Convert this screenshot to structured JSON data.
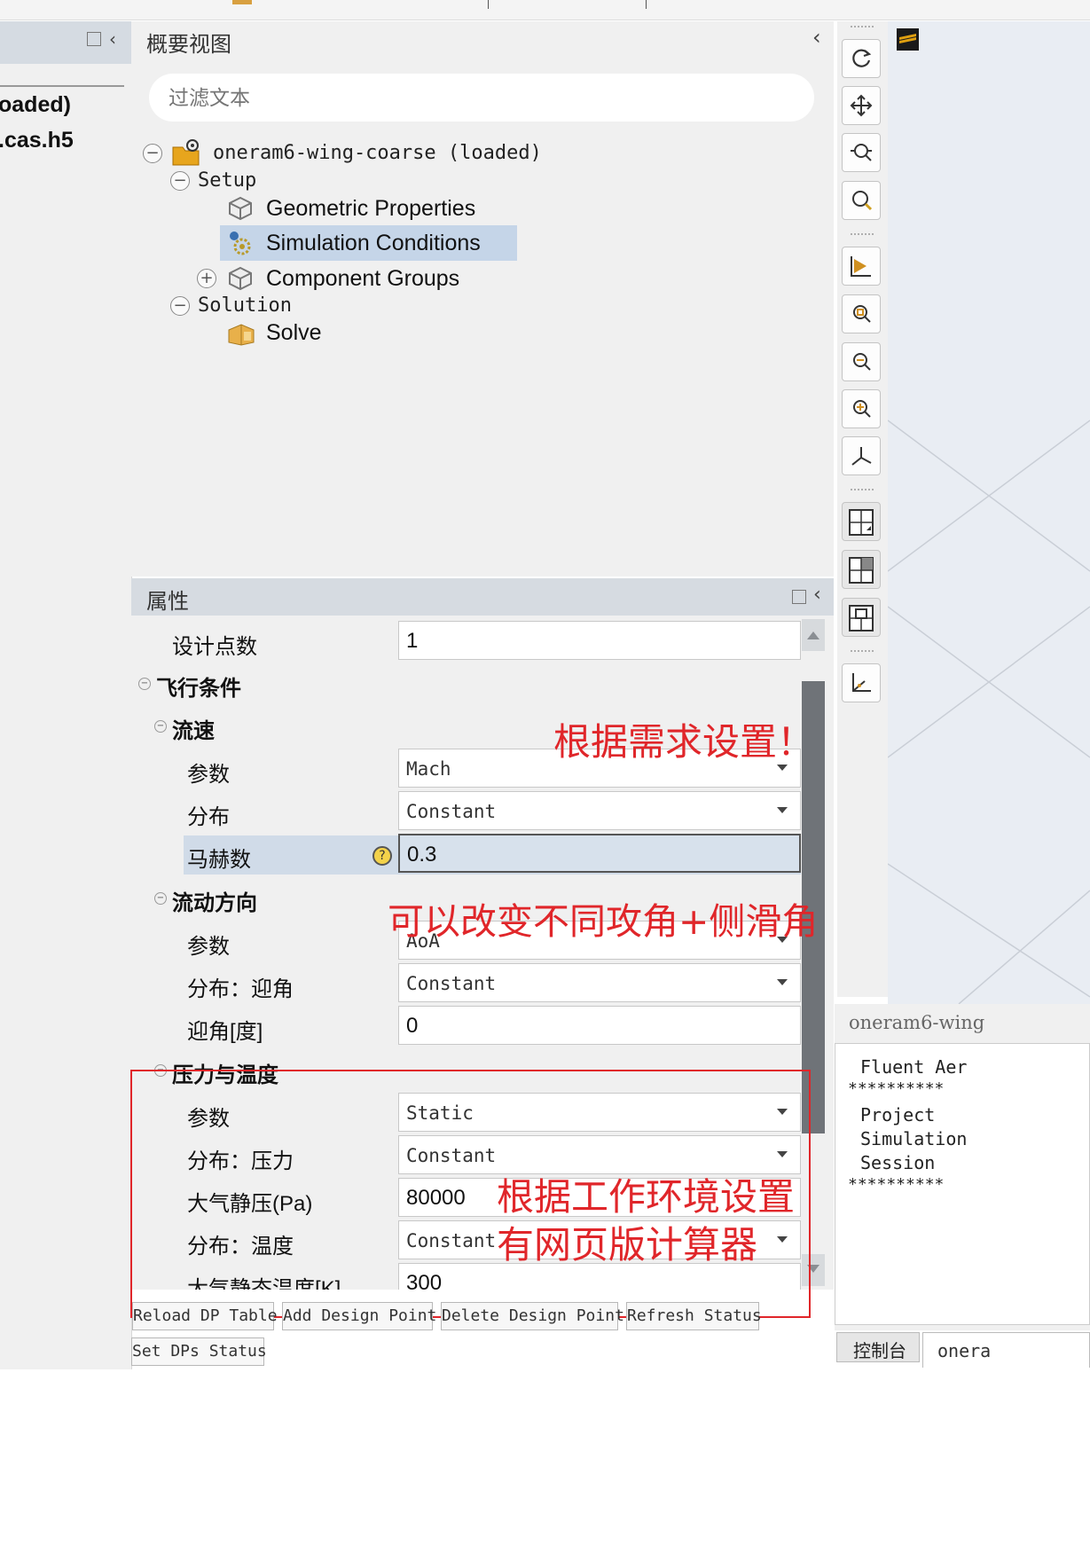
{
  "left_panel": {
    "text_line1": "oaded)",
    "text_line2": ".cas.h5"
  },
  "outline": {
    "title": "概要视图",
    "filter_placeholder": "过滤文本",
    "tree": {
      "root_label": "oneram6-wing-coarse (loaded)",
      "setup_label": "Setup",
      "geometric_label": "Geometric Properties",
      "simulation_label": "Simulation Conditions",
      "component_label": "Component Groups",
      "solution_label": "Solution",
      "solve_label": "Solve"
    }
  },
  "properties": {
    "title": "属性",
    "design_points_label": "设计点数",
    "design_points_value": "1",
    "flight_conditions": "飞行条件",
    "flow_speed": {
      "section": "流速",
      "param_label": "参数",
      "param_value": "Mach",
      "dist_label": "分布",
      "dist_value": "Constant",
      "mach_label": "马赫数",
      "mach_value": "0.3"
    },
    "flow_direction": {
      "section": "流动方向",
      "param_label": "参数",
      "param_value": "AoA",
      "dist_label": "分布：迎角",
      "dist_value": "Constant",
      "aoa_label": "迎角[度]",
      "aoa_value": "0"
    },
    "pressure_temp": {
      "section": "压力与温度",
      "param_label": "参数",
      "param_value": "Static",
      "dist_p_label": "分布：压力",
      "dist_p_value": "Constant",
      "pressure_label": "大气静压(Pa)",
      "pressure_value": "80000",
      "dist_t_label": "分布：温度",
      "dist_t_value": "Constant",
      "temp_label": "大气静态温度[K]",
      "temp_value": "300"
    }
  },
  "annotations": {
    "note1": "根据需求设置！",
    "note2": "可以改变不同攻角+侧滑角",
    "note3": "根据工作环境设置",
    "note4": "有网页版计算器",
    "color": "#e0262a"
  },
  "buttons": {
    "reload": "Reload DP Table",
    "add": "Add Design Point",
    "delete": "Delete Design Point",
    "refresh": "Refresh Status",
    "set": "Set DPs Status"
  },
  "console": {
    "title": "oneram6-wing",
    "line1": "Fluent Aer",
    "stars": "**********",
    "line2": "Project",
    "line3": "Simulation",
    "line4": "Session",
    "tab_console": "控制台",
    "tab_other": "onera"
  },
  "toolbar_icons": [
    "rotate-icon",
    "pan-icon",
    "zoom-box-icon",
    "zoom-icon",
    "fit-view-icon",
    "zoom-fit-icon",
    "zoom-out-icon",
    "zoom-in-icon",
    "axes-icon",
    "layout-1-icon",
    "layout-2-icon",
    "layout-3-icon",
    "axis-triad-icon"
  ]
}
